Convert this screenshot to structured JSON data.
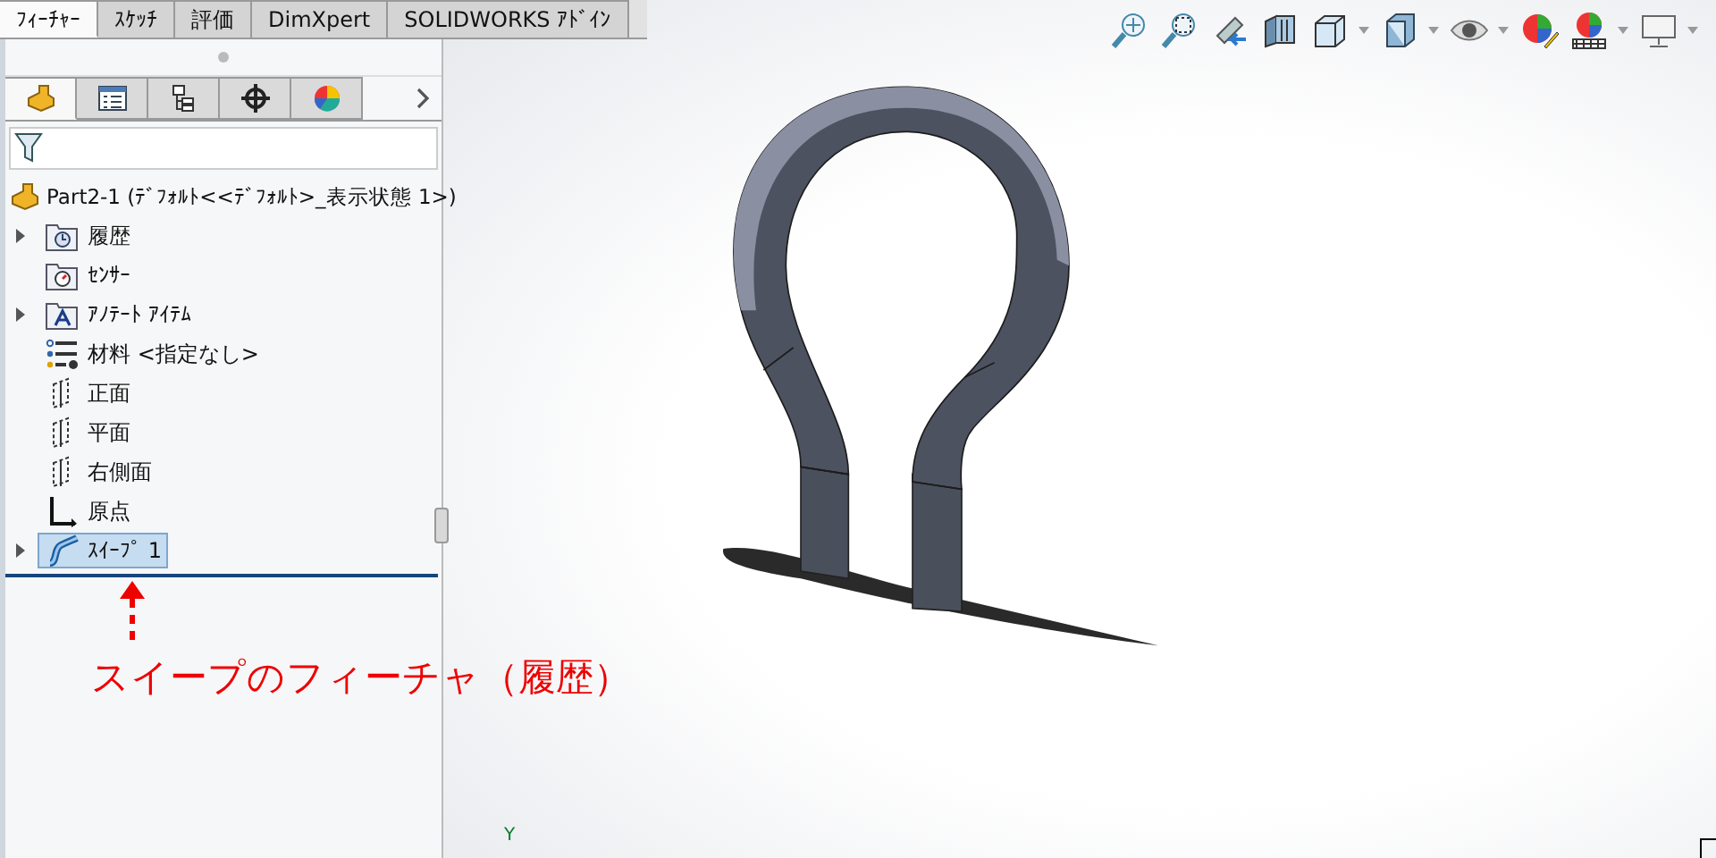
{
  "command_tabs": [
    {
      "label": "ﾌｨｰﾁｬｰ",
      "selected": true
    },
    {
      "label": "ｽｹｯﾁ",
      "selected": false
    },
    {
      "label": "評価",
      "selected": false
    },
    {
      "label": "DimXpert",
      "selected": false
    },
    {
      "label": "SOLIDWORKS ｱﾄﾞｲﾝ",
      "selected": false
    }
  ],
  "panel_tabs": [
    {
      "kind": "feature",
      "selected": true
    },
    {
      "kind": "property",
      "selected": false
    },
    {
      "kind": "config",
      "selected": false
    },
    {
      "kind": "dimension",
      "selected": false
    },
    {
      "kind": "display",
      "selected": false
    }
  ],
  "tree": {
    "root": "Part2-1  (ﾃﾞﾌｫﾙﾄ<<ﾃﾞﾌｫﾙﾄ>_表示状態 1>)",
    "items": [
      {
        "kind": "history",
        "label": "履歴",
        "expanded": false,
        "selected": false
      },
      {
        "kind": "sensor",
        "label": "ｾﾝｻｰ",
        "selected": false
      },
      {
        "kind": "annotation",
        "label": "ｱﾉﾃｰﾄ ｱｲﾃﾑ",
        "expanded": false,
        "selected": false
      },
      {
        "kind": "material",
        "label": "材料 <指定なし>",
        "selected": false
      },
      {
        "kind": "plane",
        "label": "正面",
        "selected": false
      },
      {
        "kind": "plane",
        "label": "平面",
        "selected": false
      },
      {
        "kind": "plane",
        "label": "右側面",
        "selected": false
      },
      {
        "kind": "origin",
        "label": "原点",
        "selected": false
      },
      {
        "kind": "sweep",
        "label": "ｽｲｰﾌﾟ 1",
        "expanded": false,
        "selected": true
      }
    ]
  },
  "annotation": "スイープのフィーチャ（履歴）",
  "axis_label": "Y"
}
